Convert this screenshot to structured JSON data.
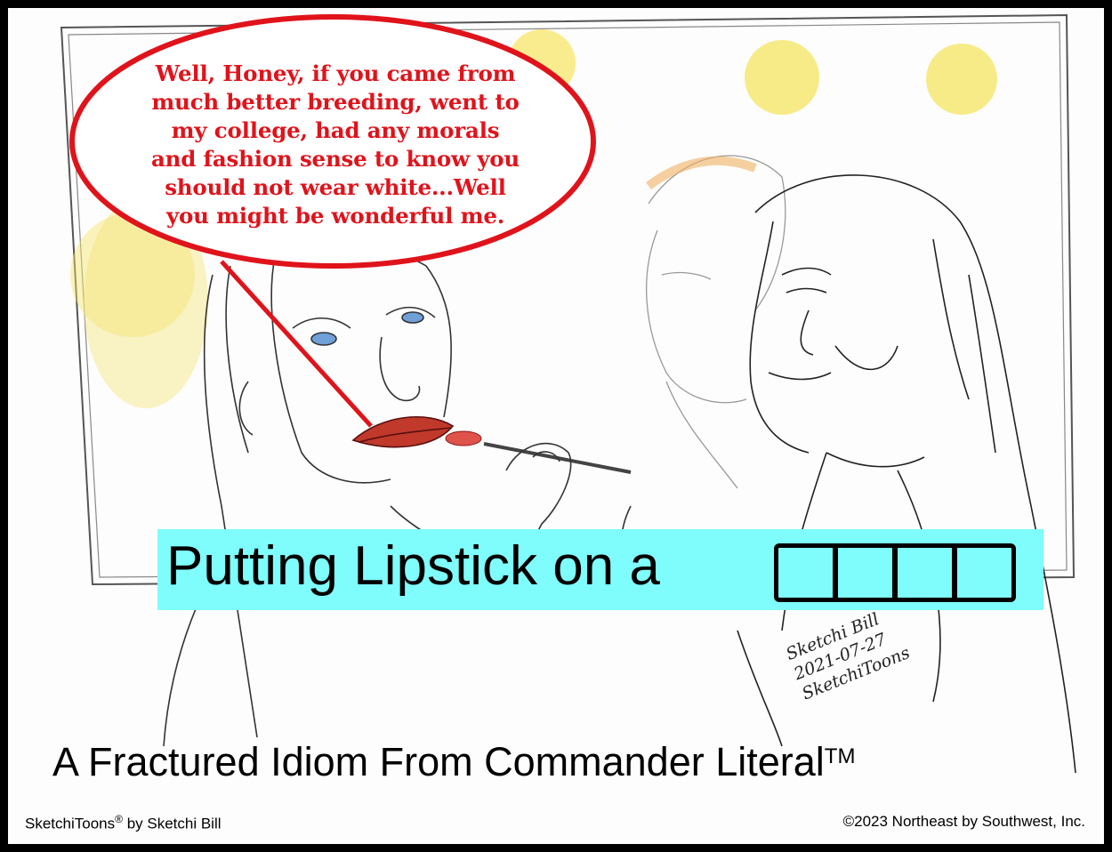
{
  "speech_bubble": {
    "lines": [
      "Well, Honey, if you came from",
      "much better breeding, went to",
      "my college, had any morals",
      "and fashion sense to know you",
      "should not wear white...Well",
      "you might be wonderful me."
    ]
  },
  "title": {
    "text": "Putting Lipstick on a",
    "blank_letters": 4
  },
  "subtitle": {
    "text": "A Fractured Idiom From Commander Literal",
    "trademark": "TM"
  },
  "footer": {
    "left_text": "SketchiToons",
    "left_registered": "®",
    "left_suffix": " by Sketchi Bill",
    "right_text": "©2023 Northeast by Southwest, Inc."
  },
  "signature": {
    "lines": [
      "Sketchi Bill",
      "2021-07-27",
      "SketchiToons"
    ]
  },
  "colors": {
    "bubble_red": "#e0131b",
    "banner_cyan": "#7ffcfc",
    "light_yellow": "#f5e66a",
    "hair_orange": "#f0b060",
    "lips_red": "#c0392b"
  }
}
